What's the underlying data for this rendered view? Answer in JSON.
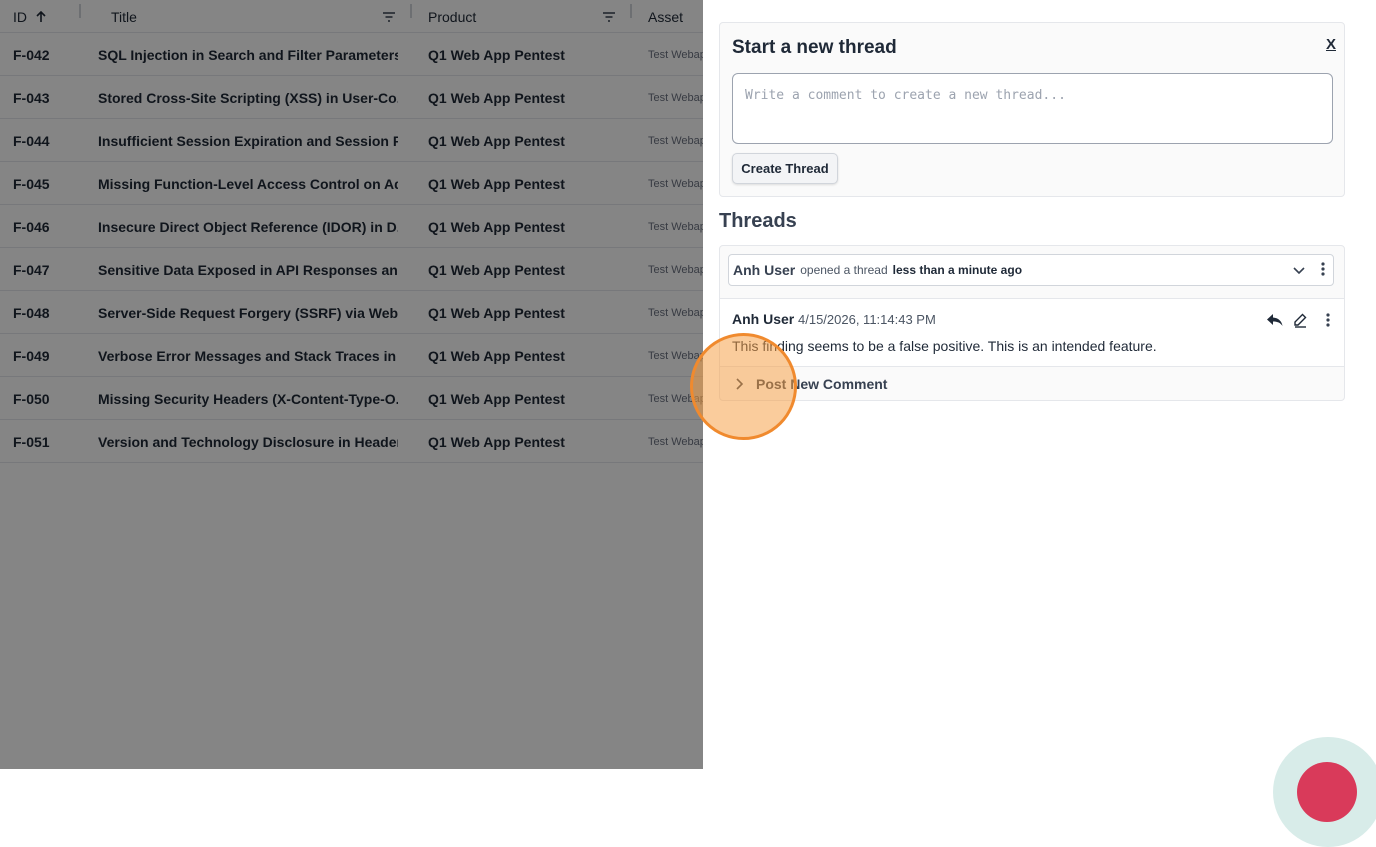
{
  "table": {
    "headers": {
      "id": "ID",
      "title": "Title",
      "product": "Product",
      "asset": "Asset"
    },
    "rows": [
      {
        "id": "F-042",
        "title": "SQL Injection in Search and Filter Parameters",
        "product": "Q1 Web App Pentest",
        "asset": "Test Webapp"
      },
      {
        "id": "F-043",
        "title": "Stored Cross-Site Scripting (XSS) in User-Co...",
        "product": "Q1 Web App Pentest",
        "asset": "Test Webapp"
      },
      {
        "id": "F-044",
        "title": "Insufficient Session Expiration and Session F...",
        "product": "Q1 Web App Pentest",
        "asset": "Test Webapp"
      },
      {
        "id": "F-045",
        "title": "Missing Function-Level Access Control on Ad...",
        "product": "Q1 Web App Pentest",
        "asset": "Test Webapp"
      },
      {
        "id": "F-046",
        "title": "Insecure Direct Object Reference (IDOR) in D...",
        "product": "Q1 Web App Pentest",
        "asset": "Test Webapp"
      },
      {
        "id": "F-047",
        "title": "Sensitive Data Exposed in API Responses an...",
        "product": "Q1 Web App Pentest",
        "asset": "Test Webapp"
      },
      {
        "id": "F-048",
        "title": "Server-Side Request Forgery (SSRF) via Web...",
        "product": "Q1 Web App Pentest",
        "asset": "Test Webapp"
      },
      {
        "id": "F-049",
        "title": "Verbose Error Messages and Stack Traces in ...",
        "product": "Q1 Web App Pentest",
        "asset": "Test Webapp"
      },
      {
        "id": "F-050",
        "title": "Missing Security Headers (X-Content-Type-O...",
        "product": "Q1 Web App Pentest",
        "asset": "Test Webapp"
      },
      {
        "id": "F-051",
        "title": "Version and Technology Disclosure in Header...",
        "product": "Q1 Web App Pentest",
        "asset": "Test Webapp"
      }
    ]
  },
  "panel": {
    "new_thread": {
      "title": "Start a new thread",
      "close_label": "X",
      "placeholder": "Write a comment to create a new thread...",
      "create_label": "Create Thread"
    },
    "threads_heading": "Threads",
    "thread": {
      "opener": "Anh User",
      "action": "opened a thread",
      "when": "less than a minute ago",
      "comment": {
        "author": "Anh User",
        "timestamp": "4/15/2026, 11:14:43 PM",
        "body": "This finding seems to be a false positive. This is an intended feature."
      },
      "post_label": "Post New Comment"
    }
  },
  "icons": [
    "sort-up-icon",
    "filter-icon",
    "chevron-down-icon",
    "more-vertical-icon",
    "reply-icon",
    "edit-icon",
    "chevron-right-icon"
  ],
  "colors": {
    "overlay": "#000000",
    "click_ring": "#f08a2e",
    "fab": "#d93a5a",
    "fab_halo": "#d8ece9"
  }
}
